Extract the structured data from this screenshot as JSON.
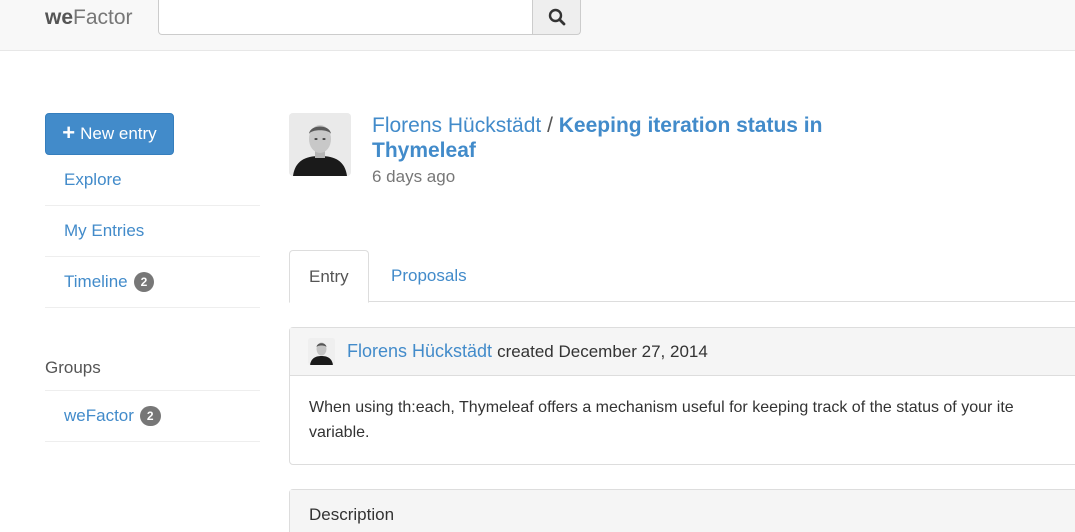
{
  "navbar": {
    "brand_bold": "we",
    "brand_rest": "Factor",
    "search_placeholder": ""
  },
  "sidebar": {
    "new_entry_label": "New entry",
    "nav": [
      {
        "label": "Explore"
      },
      {
        "label": "My Entries"
      },
      {
        "label": "Timeline",
        "badge": "2"
      }
    ],
    "groups_header": "Groups",
    "groups": [
      {
        "label": "weFactor",
        "badge": "2"
      }
    ]
  },
  "entry": {
    "author": "Florens Hückstädt",
    "separator": "/",
    "title": "Keeping iteration status in Thymeleaf",
    "age": "6 days ago"
  },
  "tabs": [
    {
      "label": "Entry",
      "active": true
    },
    {
      "label": "Proposals",
      "active": false
    }
  ],
  "revision": {
    "author": "Florens Hückstädt",
    "created_text": "created December 27, 2014",
    "body_line1": "When using th:each, Thymeleaf offers a mechanism useful for keeping track of the status of your ite",
    "body_line2": "variable."
  },
  "description_panel": {
    "heading": "Description"
  },
  "colors": {
    "link": "#428bca",
    "primary_button": "#428bca",
    "badge": "#777777"
  },
  "icons": {
    "search": "magnifier",
    "new_entry": "plus"
  }
}
